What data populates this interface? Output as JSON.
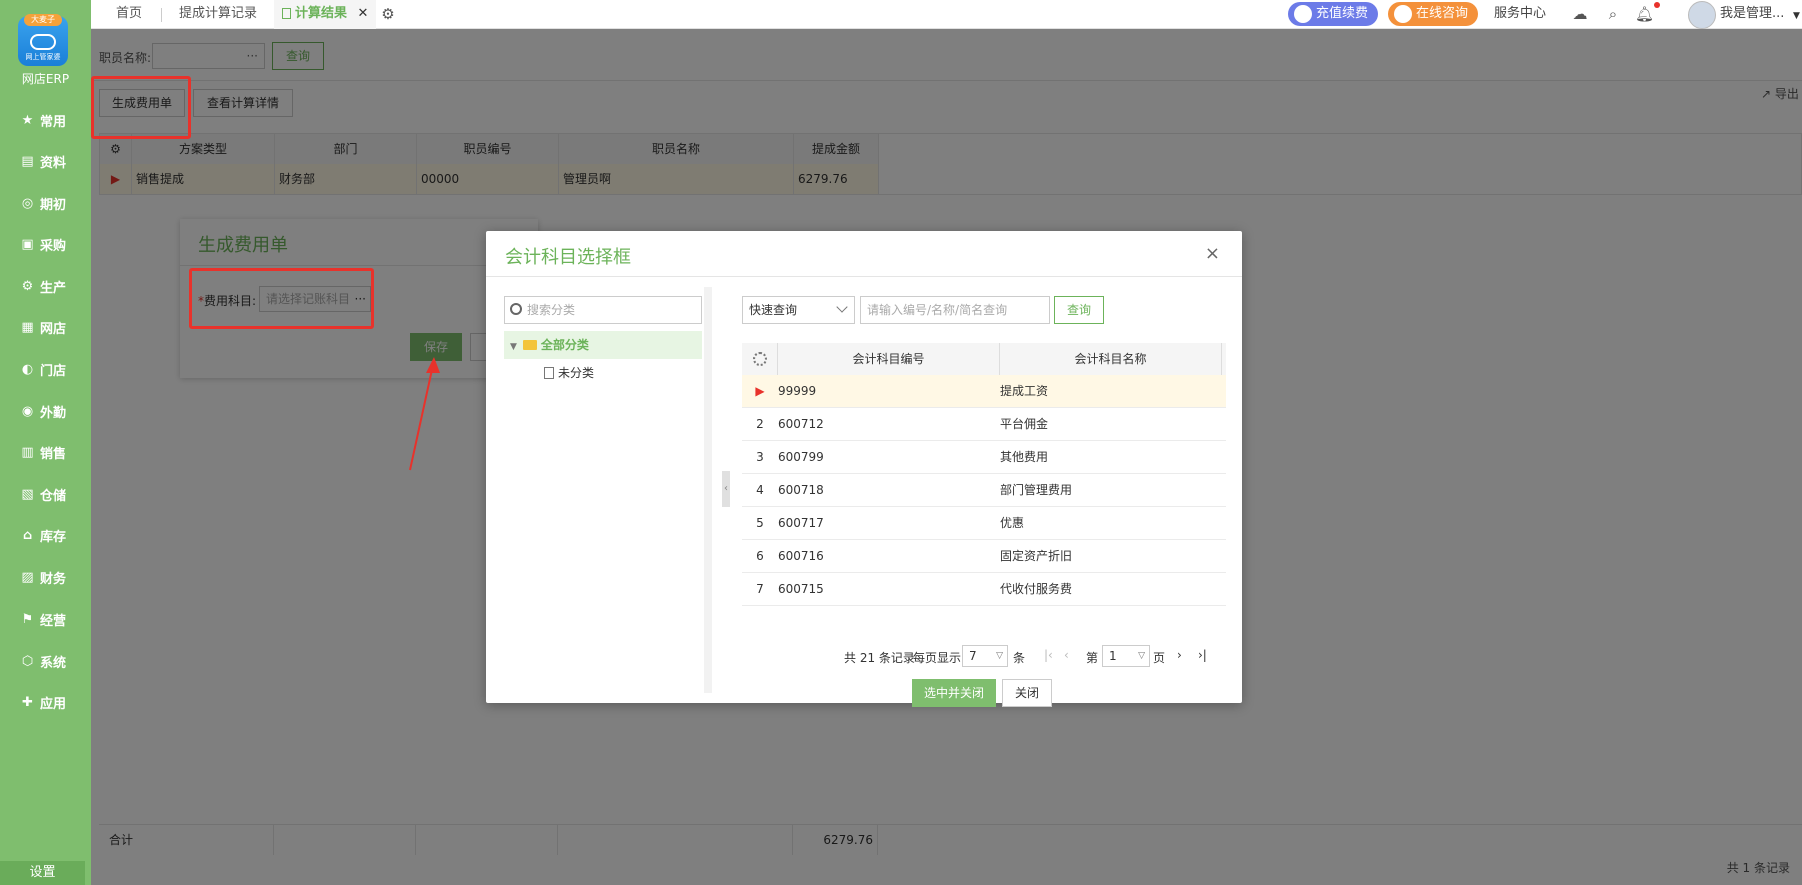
{
  "sidebar": {
    "logo_badge": "大麦子",
    "logo_sub": "网上管家婆",
    "app_name": "网店ERP",
    "items": [
      {
        "label": "常用",
        "icon": "★"
      },
      {
        "label": "资料",
        "icon": "▤"
      },
      {
        "label": "期初",
        "icon": "◎"
      },
      {
        "label": "采购",
        "icon": "▣"
      },
      {
        "label": "生产",
        "icon": "⚙"
      },
      {
        "label": "网店",
        "icon": "▦"
      },
      {
        "label": "门店",
        "icon": "◐"
      },
      {
        "label": "外勤",
        "icon": "◉"
      },
      {
        "label": "销售",
        "icon": "▥"
      },
      {
        "label": "仓储",
        "icon": "▧"
      },
      {
        "label": "库存",
        "icon": "⌂"
      },
      {
        "label": "财务",
        "icon": "▨"
      },
      {
        "label": "经营",
        "icon": "⚑"
      },
      {
        "label": "系统",
        "icon": "⬡"
      },
      {
        "label": "应用",
        "icon": "✚"
      }
    ],
    "settings": "设置"
  },
  "topbar": {
    "tabs": [
      "首页",
      "提成计算记录",
      "计算结果"
    ],
    "tab_close": "✕",
    "recharge": "充值续费",
    "consult": "在线咨询",
    "service": "服务中心",
    "user": "我是管理..."
  },
  "filter": {
    "employee_label": "职员名称:",
    "search_btn": "查询"
  },
  "toolbar": {
    "generate": "生成费用单",
    "view_detail": "查看计算详情",
    "export": "导出"
  },
  "grid": {
    "headers": [
      "方案类型",
      "部门",
      "职员编号",
      "职员名称",
      "提成金额"
    ],
    "row": [
      "销售提成",
      "财务部",
      "00000",
      "管理员啊",
      "6279.76"
    ],
    "total_label": "合计",
    "total_value": "6279.76",
    "footer": "共 1 条记录"
  },
  "dialog": {
    "title": "生成费用单",
    "required": "*",
    "field_label": "费用科目:",
    "field_placeholder": "请选择记账科目",
    "save": "保存"
  },
  "modal": {
    "title": "会计科目选择框",
    "close": "×",
    "tree_search_placeholder": "搜索分类",
    "tree_all": "全部分类",
    "tree_uncat": "未分类",
    "quick_query": "快速查询",
    "search_placeholder": "请输入编号/名称/简名查询",
    "search_btn": "查询",
    "headers": [
      "会计科目编号",
      "会计科目名称"
    ],
    "rows": [
      {
        "idx": "",
        "code": "99999",
        "name": "提成工资"
      },
      {
        "idx": "2",
        "code": "600712",
        "name": "平台佣金"
      },
      {
        "idx": "3",
        "code": "600799",
        "name": "其他费用"
      },
      {
        "idx": "4",
        "code": "600718",
        "name": "部门管理费用"
      },
      {
        "idx": "5",
        "code": "600717",
        "name": "优惠"
      },
      {
        "idx": "6",
        "code": "600716",
        "name": "固定资产折旧"
      },
      {
        "idx": "7",
        "code": "600715",
        "name": "代收付服务费"
      }
    ],
    "pager": {
      "total": "共 21 条记录",
      "per_page_label": "每页显示",
      "per_page": "7",
      "unit": "条",
      "page_prefix": "第",
      "page": "1",
      "page_suffix": "页"
    },
    "confirm": "选中并关闭",
    "cancel": "关闭"
  },
  "colors": {
    "brand": "#7fbe6e",
    "accent_text": "#6cb35a",
    "highlight": "#e8322b",
    "recharge": "#6c7be8",
    "consult": "#f4913b"
  }
}
